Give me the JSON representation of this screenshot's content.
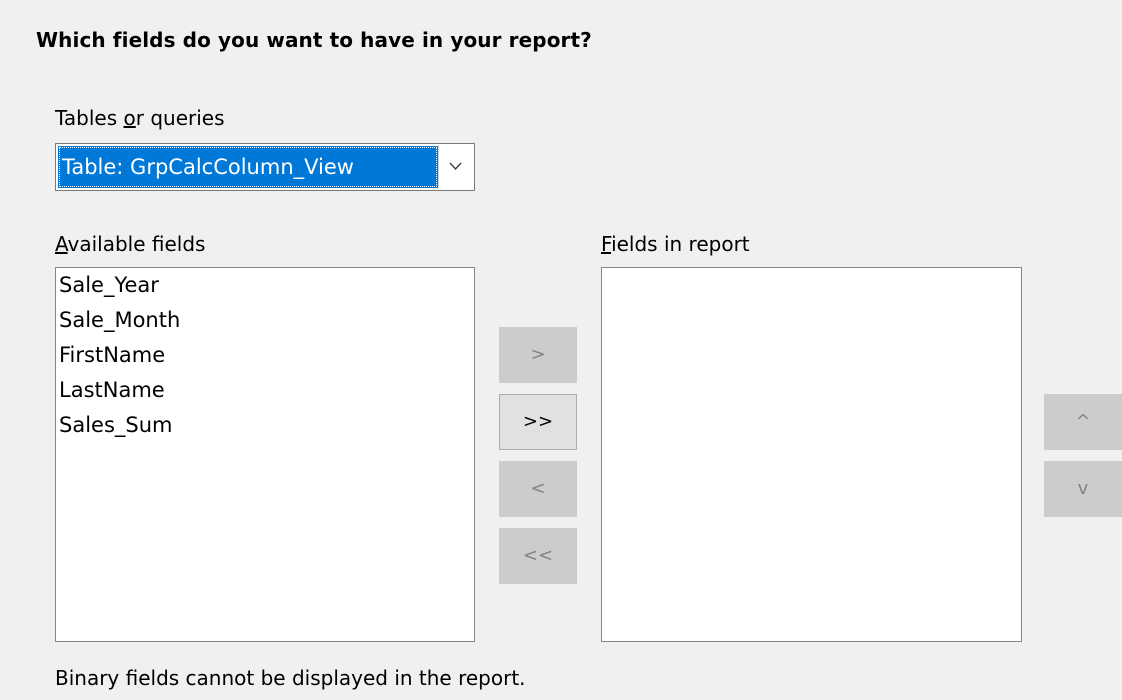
{
  "dialog": {
    "heading": "Which fields do you want to have in your report?",
    "tables_label_pre": "Tables ",
    "tables_label_key": "o",
    "tables_label_post": "r queries",
    "selected_table": "Table: GrpCalcColumn_View",
    "available_label_key": "A",
    "available_label_rest": "vailable fields",
    "report_label_key": "F",
    "report_label_rest": "ields in report",
    "available_fields": [
      "Sale_Year",
      "Sale_Month",
      "FirstName",
      "LastName",
      "Sales_Sum"
    ],
    "report_fields": [],
    "buttons": {
      "add_one": ">",
      "add_all": ">>",
      "remove_one": "<",
      "remove_all": "<<",
      "move_up": "^",
      "move_down": "v"
    },
    "note": "Binary fields cannot be displayed in the report."
  },
  "colors": {
    "background": "#f0f0f0",
    "selection": "#0078d7",
    "disabled_button": "#cccccc",
    "disabled_text": "#838383"
  }
}
